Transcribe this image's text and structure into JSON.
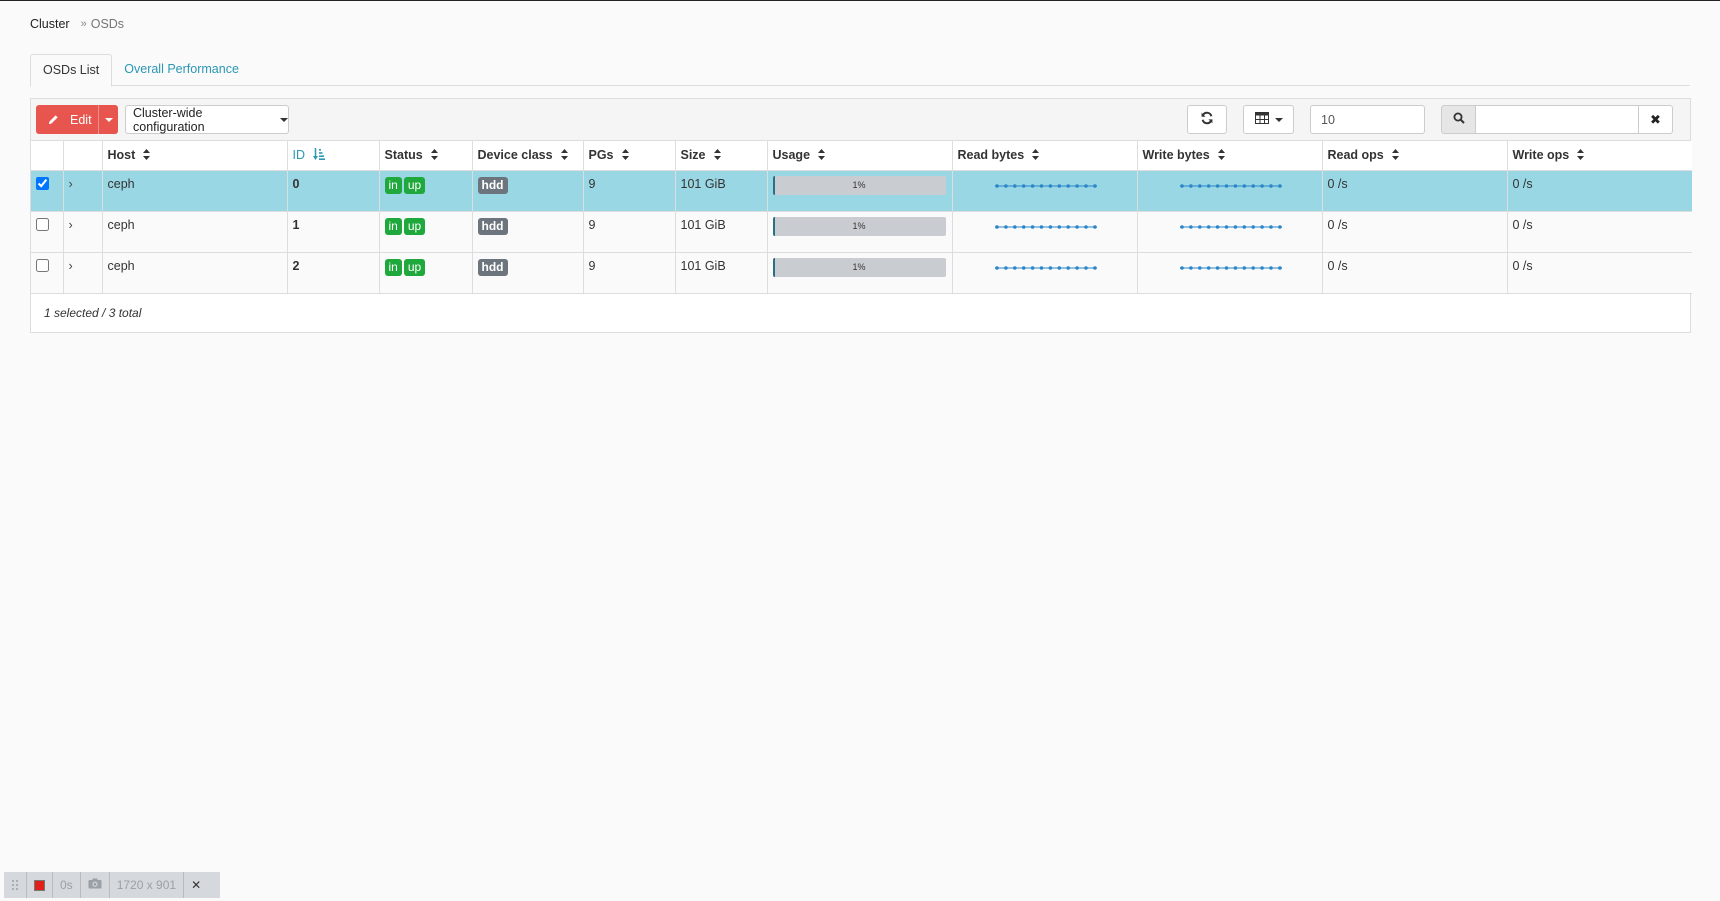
{
  "breadcrumb": {
    "root": "Cluster",
    "separator": "»",
    "current": "OSDs"
  },
  "tabs": [
    {
      "label": "OSDs List",
      "active": true
    },
    {
      "label": "Overall Performance",
      "active": false
    }
  ],
  "toolbar": {
    "edit_label": "Edit",
    "cluster_config_label": "Cluster-wide configuration",
    "page_size_value": "10",
    "search_placeholder": "",
    "refresh_icon": "refresh-icon",
    "columns_icon": "table-columns-icon",
    "search_icon": "search-icon",
    "clear_icon": "close-icon"
  },
  "table": {
    "columns": [
      "Host",
      "ID",
      "Status",
      "Device class",
      "PGs",
      "Size",
      "Usage",
      "Read bytes",
      "Write bytes",
      "Read ops",
      "Write ops"
    ],
    "sorted_column": "ID",
    "rows": [
      {
        "selected": true,
        "host": "ceph",
        "id": "0",
        "status": [
          "in",
          "up"
        ],
        "device_class": "hdd",
        "pgs": "9",
        "size": "101 GiB",
        "usage_label": "1%",
        "usage_fraction": 0.01,
        "read_ops": "0 /s",
        "write_ops": "0 /s"
      },
      {
        "selected": false,
        "host": "ceph",
        "id": "1",
        "status": [
          "in",
          "up"
        ],
        "device_class": "hdd",
        "pgs": "9",
        "size": "101 GiB",
        "usage_label": "1%",
        "usage_fraction": 0.01,
        "read_ops": "0 /s",
        "write_ops": "0 /s"
      },
      {
        "selected": false,
        "host": "ceph",
        "id": "2",
        "status": [
          "in",
          "up"
        ],
        "device_class": "hdd",
        "pgs": "9",
        "size": "101 GiB",
        "usage_label": "1%",
        "usage_fraction": 0.01,
        "read_ops": "0 /s",
        "write_ops": "0 /s"
      }
    ],
    "footer": "1 selected / 3 total"
  },
  "colors": {
    "accent": "#2b98b3",
    "edit_button": "#e8554e",
    "selected_row": "#9ad7e4",
    "badge_green": "#1fa83b",
    "badge_gray": "#6c757d",
    "sparkline": "#2a86c9"
  },
  "devbar": {
    "time": "0s",
    "size": "1720 x 901"
  }
}
